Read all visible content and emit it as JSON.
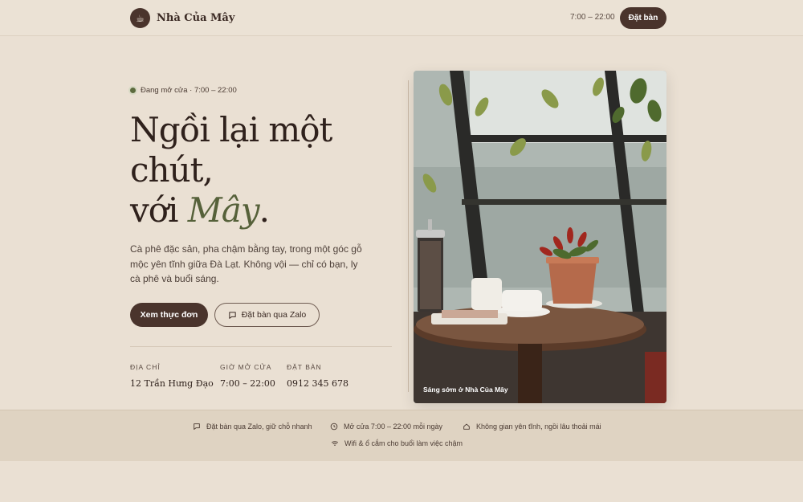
{
  "header": {
    "brand_name": "Nhà Của Mây",
    "hours": "7:00 – 22:00",
    "book_label": "Đặt bàn"
  },
  "hero": {
    "status": "Đang mở cửa · 7:00 – 22:00",
    "headline_line1": "Ngồi lại một chút,",
    "headline_prefix": "với ",
    "headline_accent": "Mây",
    "headline_suffix": ".",
    "lead": "Cà phê đặc sản, pha chậm bằng tay, trong một góc gỗ mộc yên tĩnh giữa Đà Lạt. Không vội — chỉ có bạn, ly cà phê và buổi sáng.",
    "menu_button": "Xem thực đơn",
    "zalo_button": "Đặt bàn qua Zalo",
    "info": [
      {
        "label": "Địa chỉ",
        "value": "12 Trần Hưng Đạo"
      },
      {
        "label": "Giờ mở cửa",
        "value": "7:00 – 22:00"
      },
      {
        "label": "Đặt bàn",
        "value": "0912 345 678"
      }
    ],
    "photo_caption": "Sáng sớm ở Nhà Của Mây"
  },
  "features": [
    {
      "icon": "chat-icon",
      "text": "Đặt bàn qua Zalo, giữ chỗ nhanh"
    },
    {
      "icon": "clock-icon",
      "text": "Mở cửa 7:00 – 22:00 mỗi ngày"
    },
    {
      "icon": "home-icon",
      "text": "Không gian yên tĩnh, ngồi lâu thoải mái"
    },
    {
      "icon": "wifi-icon",
      "text": "Wifi & ổ cắm cho buổi làm việc chậm"
    }
  ],
  "colors": {
    "background": "#eae0d3",
    "primary": "#4a342c",
    "accent_green": "#56613a",
    "band": "#dfd3c2"
  }
}
